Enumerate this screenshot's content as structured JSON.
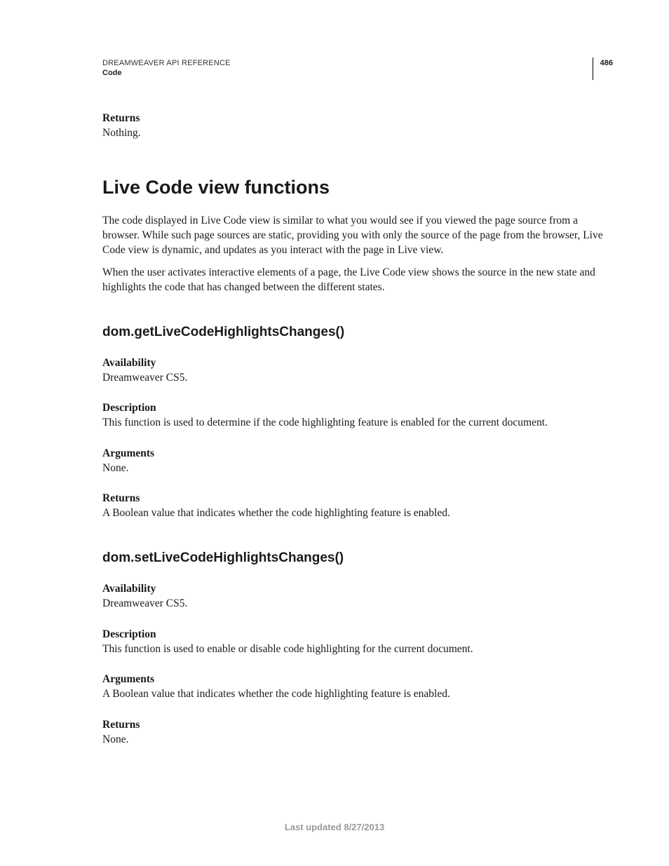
{
  "header": {
    "doc_title_small": "DREAMWEAVER API REFERENCE",
    "doc_section": "Code",
    "page_number": "486"
  },
  "prelude": {
    "returns_label": "Returns",
    "returns_value": "Nothing."
  },
  "main_heading": "Live Code view functions",
  "intro": {
    "p1": "The code displayed in Live Code view is similar to what you would see if you viewed the page source from a browser. While such page sources are static, providing you with only the source of the page from the browser, Live Code view is dynamic, and updates as you interact with the page in Live view.",
    "p2": "When the user activates interactive elements of a page, the Live Code view shows the source in the new state and highlights the code that has changed between the different states."
  },
  "functions": [
    {
      "name": "dom.getLiveCodeHighlightsChanges()",
      "availability_label": "Availability",
      "availability_value": "Dreamweaver CS5.",
      "description_label": "Description",
      "description_value": "This function is used to determine if the code highlighting feature is enabled for the current document.",
      "arguments_label": "Arguments",
      "arguments_value": "None.",
      "returns_label": "Returns",
      "returns_value": "A Boolean value that indicates whether the code highlighting feature is enabled."
    },
    {
      "name": "dom.setLiveCodeHighlightsChanges()",
      "availability_label": "Availability",
      "availability_value": "Dreamweaver CS5.",
      "description_label": "Description",
      "description_value": "This function is used to enable or disable code highlighting for the current document.",
      "arguments_label": "Arguments",
      "arguments_value": "A Boolean value that indicates whether the code highlighting feature is enabled.",
      "returns_label": "Returns",
      "returns_value": "None."
    }
  ],
  "footer": "Last updated 8/27/2013"
}
